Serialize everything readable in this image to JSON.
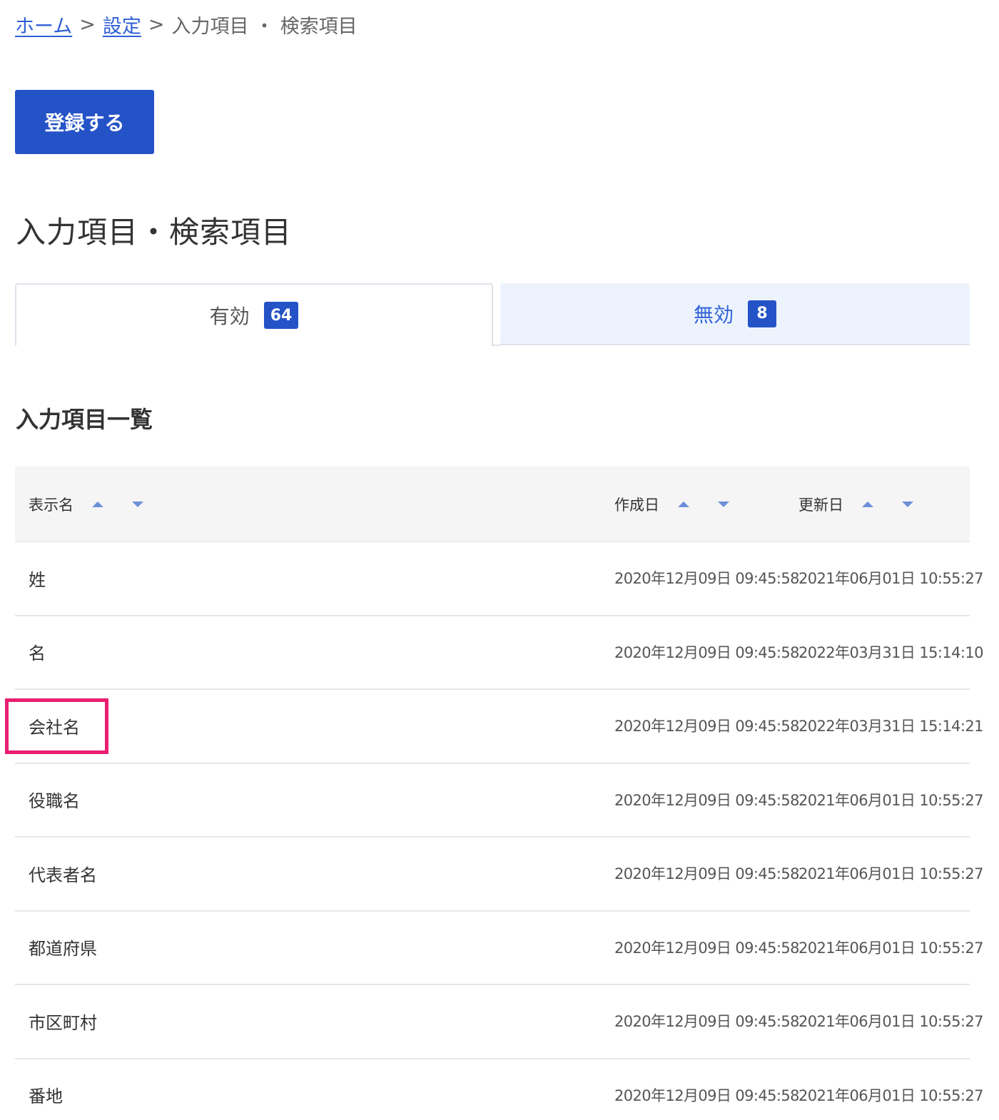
{
  "breadcrumb": {
    "home": "ホーム",
    "settings": "設定",
    "current": "入力項目 ・ 検索項目",
    "separator": ">"
  },
  "register_button": "登録する",
  "page_title": "入力項目・検索項目",
  "tabs": [
    {
      "label": "有効",
      "count": "64"
    },
    {
      "label": "無効",
      "count": "8"
    }
  ],
  "section_title": "入力項目一覧",
  "table": {
    "headers": {
      "name": "表示名",
      "created": "作成日",
      "updated": "更新日"
    },
    "rows": [
      {
        "name": "姓",
        "created": "2020年12月09日 09:45:58",
        "updated": "2021年06月01日 10:55:27"
      },
      {
        "name": "名",
        "created": "2020年12月09日 09:45:58",
        "updated": "2022年03月31日 15:14:10"
      },
      {
        "name": "会社名",
        "created": "2020年12月09日 09:45:58",
        "updated": "2022年03月31日 15:14:21"
      },
      {
        "name": "役職名",
        "created": "2020年12月09日 09:45:58",
        "updated": "2021年06月01日 10:55:27"
      },
      {
        "name": "代表者名",
        "created": "2020年12月09日 09:45:58",
        "updated": "2021年06月01日 10:55:27"
      },
      {
        "name": "都道府県",
        "created": "2020年12月09日 09:45:58",
        "updated": "2021年06月01日 10:55:27"
      },
      {
        "name": "市区町村",
        "created": "2020年12月09日 09:45:58",
        "updated": "2021年06月01日 10:55:27"
      },
      {
        "name": "番地",
        "created": "2020年12月09日 09:45:58",
        "updated": "2021年06月01日 10:55:27"
      }
    ]
  },
  "colors": {
    "primary": "#2453c7",
    "link": "#2e5fd8",
    "inactive_tab_bg": "#edf3fd",
    "highlight": "#e91e72"
  }
}
